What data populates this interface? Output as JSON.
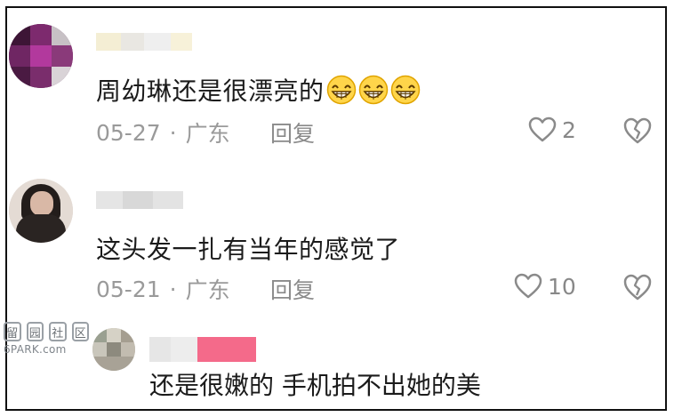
{
  "comments": [
    {
      "text": "周幼琳还是很漂亮的",
      "emoji": [
        "grinning-emoji",
        "grinning-emoji",
        "grinning-emoji"
      ],
      "date": "05-27",
      "location": "广东",
      "reply_label": "回复",
      "likes": "2"
    },
    {
      "text": "这头发一扎有当年的感觉了",
      "date": "05-21",
      "location": "广东",
      "reply_label": "回复",
      "likes": "10"
    },
    {
      "text": "还是很嫩的 手机拍不出她的美"
    }
  ],
  "watermark": {
    "chars": [
      "留",
      "园",
      "社",
      "区"
    ],
    "url": "6PARK.com"
  },
  "separator": "·",
  "colors": {
    "text": "#1b1b1b",
    "meta": "#9a9a9a",
    "icon": "#888888",
    "badge_pink": "#f46a8a"
  }
}
